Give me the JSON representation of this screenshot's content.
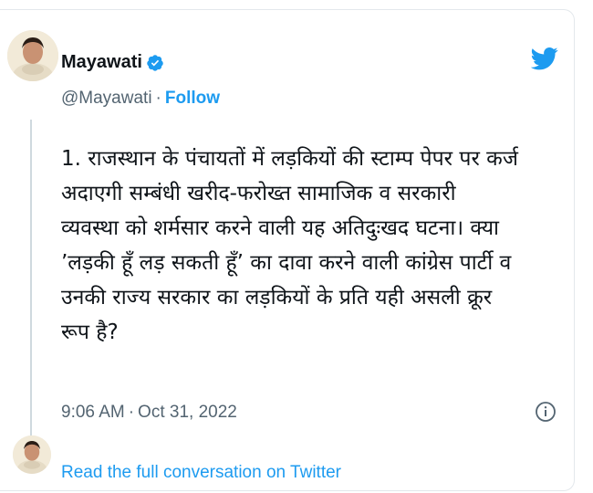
{
  "tweet": {
    "display_name": "Mayawati",
    "handle": "@Mayawati",
    "separator": "·",
    "follow_label": "Follow",
    "text_lines": [
      "1. राजस्थान के पंचायतों में लड़कियों की स्टाम्प पेपर पर कर्ज",
      "अदाएगी सम्बंधी खरीद-फरोख्त सामाजिक व सरकारी",
      "व्यवस्था को शर्मसार करने वाली यह अतिदुःखद घटना। क्या",
      "’लड़की हूँ लड़ सकती हूँ’ का दावा करने वाली कांग्रेस पार्टी व",
      "उनकी राज्य सरकार का लड़कियों के प्रति यही असली क्रूर",
      "रूप है?"
    ],
    "time": "9:06 AM",
    "date": "Oct 31, 2022",
    "read_conversation_label": "Read the full conversation on Twitter"
  },
  "icons": {
    "verified": "verified-badge-icon",
    "twitter": "twitter-bird-icon",
    "info": "info-icon"
  },
  "colors": {
    "accent": "#1d9bf0",
    "text": "#0f1419",
    "secondary": "#536471"
  }
}
